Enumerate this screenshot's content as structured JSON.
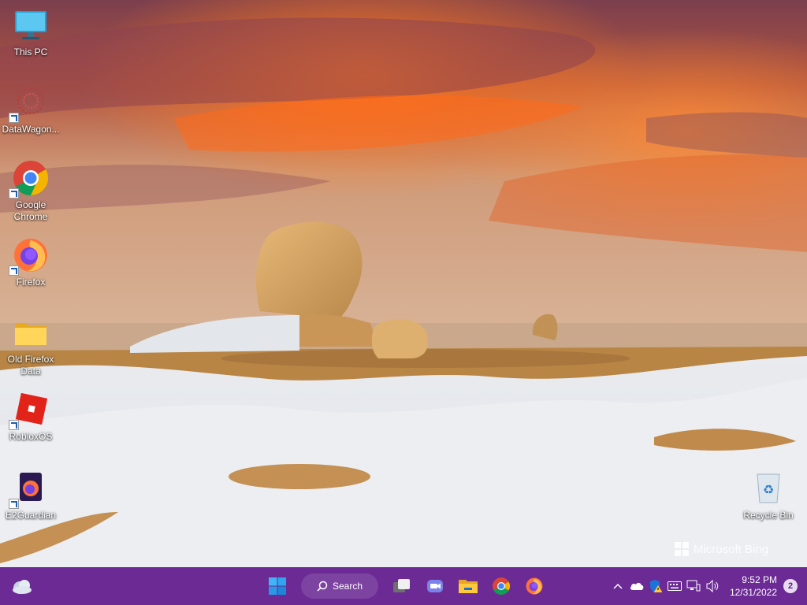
{
  "desktop": {
    "icons": [
      {
        "label": "This PC"
      },
      {
        "label": "DataWagon..."
      },
      {
        "label": "Google Chrome"
      },
      {
        "label": "Firefox"
      },
      {
        "label": "Old Firefox Data"
      },
      {
        "label": "RobloxOS"
      },
      {
        "label": "E2Guardian"
      },
      {
        "label": "Recycle Bin"
      }
    ],
    "watermark": "Microsoft Bing"
  },
  "taskbar": {
    "search_label": "Search",
    "apps": [
      "widgets-icon",
      "start-icon",
      "search-icon",
      "task-view-icon",
      "teams-chat-icon",
      "file-explorer-icon",
      "chrome-icon",
      "firefox-icon"
    ],
    "tray": {
      "time": "9:52 PM",
      "date": "12/31/2022",
      "notification_count": "2"
    }
  },
  "colors": {
    "taskbar": "#6b2a94",
    "accent": "#0078d4"
  }
}
